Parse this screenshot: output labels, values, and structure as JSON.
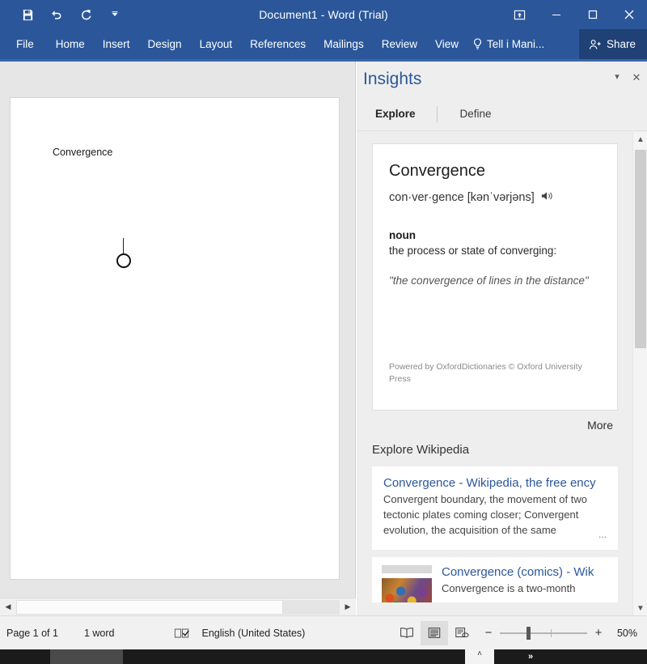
{
  "titlebar": {
    "title": "Document1 - Word (Trial)",
    "quick_access": [
      {
        "name": "save-icon",
        "label": "Save"
      },
      {
        "name": "undo-icon",
        "label": "Undo"
      },
      {
        "name": "redo-icon",
        "label": "Redo"
      },
      {
        "name": "customize-qat-icon",
        "label": "Customize Quick Access Toolbar"
      }
    ],
    "window_controls": [
      {
        "name": "ribbon-display-options-icon",
        "label": "Ribbon Display Options"
      },
      {
        "name": "minimize-icon",
        "label": "Minimize"
      },
      {
        "name": "maximize-icon",
        "label": "Maximize"
      },
      {
        "name": "close-icon",
        "label": "Close"
      }
    ]
  },
  "ribbon": {
    "tabs": [
      {
        "label": "File"
      },
      {
        "label": "Home"
      },
      {
        "label": "Insert"
      },
      {
        "label": "Design"
      },
      {
        "label": "Layout"
      },
      {
        "label": "References"
      },
      {
        "label": "Mailings"
      },
      {
        "label": "Review"
      },
      {
        "label": "View"
      }
    ],
    "tell_me": "Tell i Mani...",
    "share_label": "Share"
  },
  "document": {
    "text": "Convergence"
  },
  "pane": {
    "title": "Insights",
    "tabs": [
      {
        "label": "Explore",
        "active": true
      },
      {
        "label": "Define",
        "active": false
      }
    ],
    "definition": {
      "word": "Convergence",
      "pronunciation": "con·ver·gence [kənˈvərjəns]",
      "speaker_icon": "speaker-icon",
      "part_of_speech": "noun",
      "meaning": "the process or state of converging:",
      "example": "\"the convergence of lines in the distance\"",
      "attribution": "Powered by OxfordDictionaries © Oxford University Press"
    },
    "more_label": "More",
    "wikipedia_section_title": "Explore Wikipedia",
    "wikipedia_results": [
      {
        "title": "Convergence - Wikipedia, the free ency",
        "snippet": "Convergent boundary, the movement of two tectonic plates coming closer; Convergent evolution, the acquisition of the same",
        "ellipsis": "..."
      },
      {
        "title": "Convergence (comics) - Wik",
        "snippet": "Convergence is a two-month"
      }
    ]
  },
  "statusbar": {
    "page": "Page 1 of 1",
    "words": "1 word",
    "proofing_icon": "proofing-check-icon",
    "language": "English (United States)",
    "views": [
      {
        "name": "read-mode-icon",
        "label": "Read Mode",
        "active": false
      },
      {
        "name": "print-layout-icon",
        "label": "Print Layout",
        "active": true
      },
      {
        "name": "web-layout-icon",
        "label": "Web Layout",
        "active": false
      }
    ],
    "zoom_out": "−",
    "zoom_in": "+",
    "zoom_level": "50%"
  },
  "taskbar": {
    "chevron": "˄",
    "expand": "»"
  },
  "colors": {
    "word_blue": "#2b579a",
    "share_blue": "#204175",
    "link_blue": "#2b579a",
    "pane_bg": "#eeeeee"
  }
}
